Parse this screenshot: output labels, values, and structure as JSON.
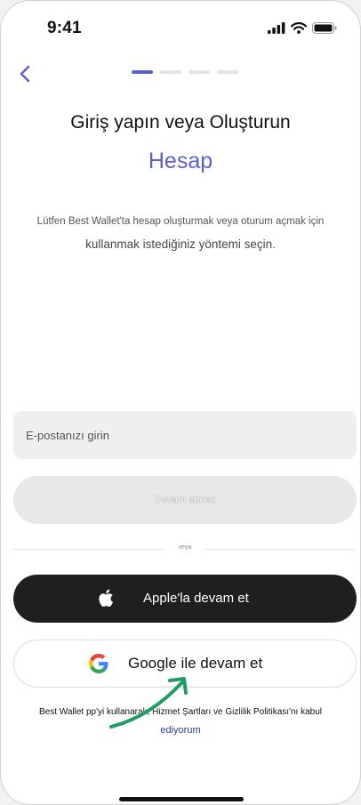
{
  "status_bar": {
    "time": "9:41"
  },
  "header": {
    "steps_total": 4,
    "current_step": 1
  },
  "main": {
    "title": "Giriş yapın veya Oluşturun",
    "subtitle": "Hesap",
    "description_line1": "Lütfen Best Wallet'ta hesap oluşturmak veya oturum açmak için",
    "description_line2": "kullanmak istediğiniz yöntemi seçin."
  },
  "form": {
    "email_placeholder": "E-postanızı girin",
    "email_value": "",
    "continue_label": "Devam etmek"
  },
  "divider_label": "veya",
  "apple_button": {
    "label": "Apple'la devam et"
  },
  "google_button": {
    "label": "Google ile devam et"
  },
  "terms": {
    "line1": "Best Wallet pp'yi kullanarak, Hizmet Şartları ve Gizlilik Politikası'nı kabul",
    "line2": "ediyorum"
  },
  "colors": {
    "accent": "#5a5fd1",
    "dark_button": "#1f1f1f",
    "annotation_arrow": "#1f9d63"
  }
}
